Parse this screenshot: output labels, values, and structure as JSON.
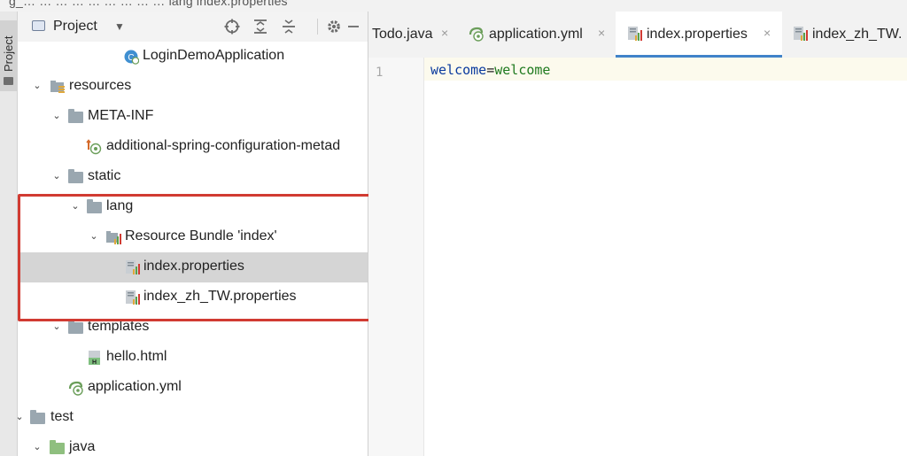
{
  "topbar": {
    "breadcrumb": "g_… … … … … … … … … lang  index.properties"
  },
  "vertical_tab": {
    "label": "Project"
  },
  "project_panel": {
    "title": "Project",
    "tree": [
      {
        "label": "LoginDemoApplication",
        "icon": "spring-boot-class-icon"
      },
      {
        "label": "resources",
        "icon": "resources-folder-icon",
        "expanded": true
      },
      {
        "label": "META-INF",
        "icon": "folder-icon",
        "expanded": true
      },
      {
        "label": "additional-spring-configuration-metad",
        "icon": "spring-metadata-file-icon"
      },
      {
        "label": "static",
        "icon": "folder-icon",
        "expanded": true
      },
      {
        "label": "lang",
        "icon": "folder-icon",
        "expanded": true
      },
      {
        "label": "Resource Bundle 'index'",
        "icon": "resource-bundle-icon",
        "expanded": true
      },
      {
        "label": "index.properties",
        "icon": "properties-file-icon",
        "selected": true
      },
      {
        "label": "index_zh_TW.properties",
        "icon": "properties-file-icon"
      },
      {
        "label": "templates",
        "icon": "folder-icon",
        "expanded": true
      },
      {
        "label": "hello.html",
        "icon": "html-file-icon"
      },
      {
        "label": "application.yml",
        "icon": "spring-yml-file-icon"
      },
      {
        "label": "test",
        "icon": "folder-icon",
        "expanded": true
      },
      {
        "label": "java",
        "icon": "test-source-folder-icon",
        "expanded": true
      }
    ]
  },
  "editor": {
    "tabs": [
      {
        "label": "Todo.java",
        "icon": "java-class-icon"
      },
      {
        "label": "application.yml",
        "icon": "spring-yml-file-icon"
      },
      {
        "label": "index.properties",
        "icon": "properties-file-icon",
        "active": true
      },
      {
        "label": "index_zh_TW.",
        "icon": "properties-file-icon"
      }
    ],
    "close_glyph": "×",
    "lines": [
      {
        "number": "1",
        "key": "welcome",
        "sep": "=",
        "value": "welcome"
      }
    ]
  },
  "colors": {
    "highlight_box": "#d13b32",
    "active_tab_underline": "#4083c9",
    "selection": "#d5d5d5",
    "property_key": "#0a3a9e",
    "property_value": "#1f7a1f"
  }
}
